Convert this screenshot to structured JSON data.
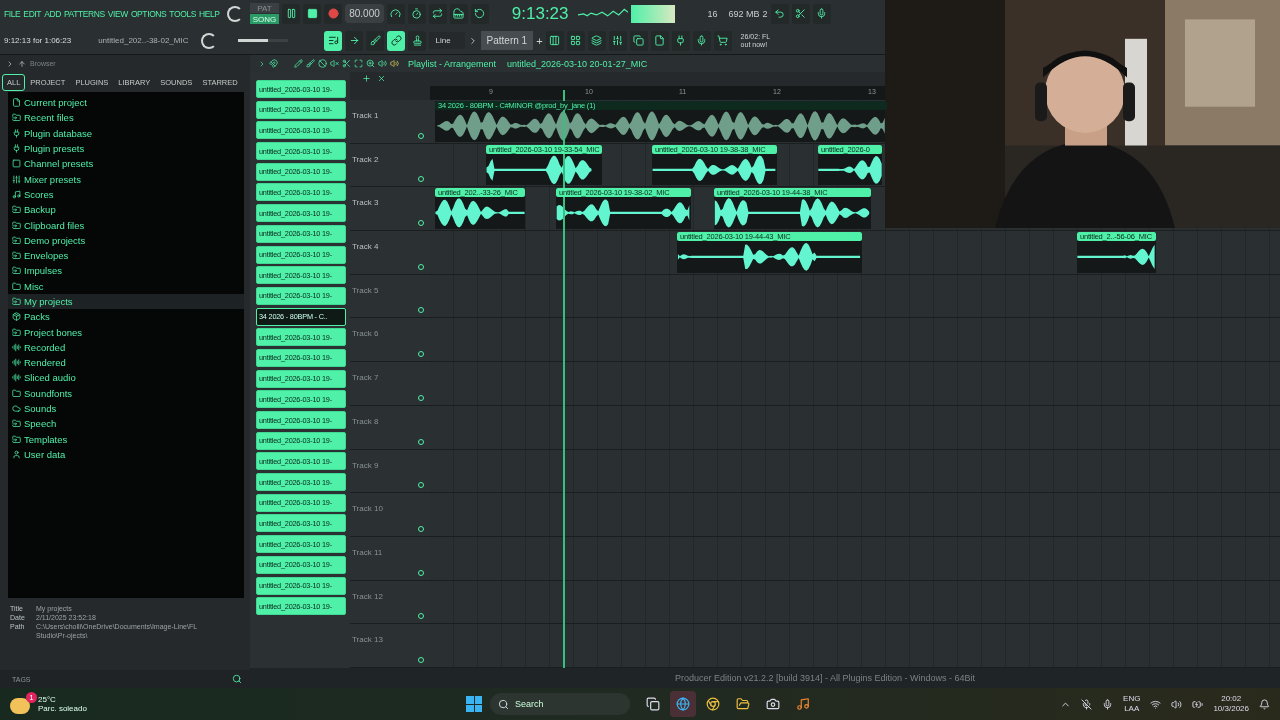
{
  "menu": [
    "FILE",
    "EDIT",
    "ADD",
    "PATTERNS",
    "VIEW",
    "OPTIONS",
    "TOOLS",
    "HELP"
  ],
  "transport": {
    "modes": [
      {
        "label": "PAT",
        "selected": false
      },
      {
        "label": "SONG",
        "selected": true
      }
    ],
    "playing": true,
    "tempo": "80.000",
    "time": "9:13:23",
    "cpu": "16",
    "memory": "692 MB",
    "polyphony": "2"
  },
  "hint": {
    "text": "9:12:13 for 1:06:23",
    "file": "untitled_202..-38-02_MIC"
  },
  "master": {
    "level": 0.6
  },
  "tools": [
    {
      "kind": "playlist",
      "on": true
    },
    {
      "kind": "arrow",
      "on": false
    },
    {
      "kind": "brush",
      "on": false
    },
    {
      "kind": "link",
      "on": true
    },
    {
      "kind": "stamp",
      "on": false
    }
  ],
  "snap": "Line",
  "pattern": "Pattern 1",
  "pattern_add": "+",
  "news": [
    "26/02: FL",
    "out now!"
  ],
  "browser": {
    "title": "Browser",
    "tabs": [
      {
        "label": "ALL",
        "selected": true
      },
      {
        "label": "PROJECT",
        "selected": false
      },
      {
        "label": "PLUGINS",
        "selected": false
      },
      {
        "label": "LIBRARY",
        "selected": false
      },
      {
        "label": "SOUNDS",
        "selected": false
      },
      {
        "label": "STARRED",
        "selected": false
      }
    ],
    "items": [
      {
        "label": "Current project",
        "kind": "file",
        "selected": false
      },
      {
        "label": "Recent files",
        "kind": "linked",
        "selected": false
      },
      {
        "label": "Plugin database",
        "kind": "plugin",
        "selected": false
      },
      {
        "label": "Plugin presets",
        "kind": "plugin",
        "selected": false
      },
      {
        "label": "Channel presets",
        "kind": "channel",
        "selected": false
      },
      {
        "label": "Mixer presets",
        "kind": "mixer",
        "selected": false
      },
      {
        "label": "Scores",
        "kind": "score",
        "selected": false
      },
      {
        "label": "Backup",
        "kind": "linked",
        "selected": false
      },
      {
        "label": "Clipboard files",
        "kind": "linked",
        "selected": false
      },
      {
        "label": "Demo projects",
        "kind": "linked",
        "selected": false
      },
      {
        "label": "Envelopes",
        "kind": "linked",
        "selected": false
      },
      {
        "label": "Impulses",
        "kind": "linked",
        "selected": false
      },
      {
        "label": "Misc",
        "kind": "folder",
        "selected": false
      },
      {
        "label": "My projects",
        "kind": "linked",
        "selected": true
      },
      {
        "label": "Packs",
        "kind": "packs",
        "selected": false
      },
      {
        "label": "Project bones",
        "kind": "linked",
        "selected": false
      },
      {
        "label": "Recorded",
        "kind": "audio",
        "selected": false
      },
      {
        "label": "Rendered",
        "kind": "audio",
        "selected": false
      },
      {
        "label": "Sliced audio",
        "kind": "audio",
        "selected": false
      },
      {
        "label": "Soundfonts",
        "kind": "folder",
        "selected": false
      },
      {
        "label": "Sounds",
        "kind": "cloud",
        "selected": false
      },
      {
        "label": "Speech",
        "kind": "linked",
        "selected": false
      },
      {
        "label": "Templates",
        "kind": "linked",
        "selected": false
      },
      {
        "label": "User data",
        "kind": "user",
        "selected": false
      }
    ],
    "info": [
      {
        "key": "Title",
        "value": "My projects"
      },
      {
        "key": "Date",
        "value": "2/11/2025 23:52:18"
      },
      {
        "key": "Path",
        "value": "C:\\Users\\cholli\\OneDrive\\Documents\\Image-Line\\FL Studio\\Pr-ojects\\"
      }
    ],
    "tags": "TAGS"
  },
  "clips_list": [
    {
      "label": "untitled_2026-03-10 19-",
      "selected": false
    },
    {
      "label": "untitled_2026-03-10 19-",
      "selected": false
    },
    {
      "label": "untitled_2026-03-10 19-",
      "selected": false
    },
    {
      "label": "untitled_2026-03-10 19-",
      "selected": false
    },
    {
      "label": "untitled_2026-03-10 19-",
      "selected": false
    },
    {
      "label": "untitled_2026-03-10 19-",
      "selected": false
    },
    {
      "label": "untitled_2026-03-10 19-",
      "selected": false
    },
    {
      "label": "untitled_2026-03-10 19-",
      "selected": false
    },
    {
      "label": "untitled_2026-03-10 19-",
      "selected": false
    },
    {
      "label": "untitled_2026-03-10 19-",
      "selected": false
    },
    {
      "label": "untitled_2026-03-10 19-",
      "selected": false
    },
    {
      "label": "34 2026 - 80BPM - C..",
      "selected": true
    },
    {
      "label": "untitled_2026-03-10 19-",
      "selected": false
    },
    {
      "label": "untitled_2026-03-10 19-",
      "selected": false
    },
    {
      "label": "untitled_2026-03-10 19-",
      "selected": false
    },
    {
      "label": "untitled_2026-03-10 19-",
      "selected": false
    },
    {
      "label": "untitled_2026-03-10 19-",
      "selected": false
    },
    {
      "label": "untitled_2026-03-10 19-",
      "selected": false
    },
    {
      "label": "untitled_2026-03-10 19-",
      "selected": false
    },
    {
      "label": "untitled_2026-03-10 19-",
      "selected": false
    },
    {
      "label": "untitled_2026-03-10 19-",
      "selected": false
    },
    {
      "label": "untitled_2026-03-10 19-",
      "selected": false
    },
    {
      "label": "untitled_2026-03-10 19-",
      "selected": false
    },
    {
      "label": "untitled_2026-03-10 19-",
      "selected": false
    },
    {
      "label": "untitled_2026-03-10 19-",
      "selected": false
    },
    {
      "label": "untitled_2026-03-10 19-",
      "selected": false
    }
  ],
  "playlist": {
    "title": "Playlist - Arrangement",
    "file": "untitled_2026-03-10 20-01-27_MIC",
    "ruler": [
      "9",
      "10",
      "11",
      "12",
      "13"
    ],
    "tracks": [
      {
        "name": "Track 1",
        "clips": [
          {
            "label": "34 2026 - 80BPM - C#MINOR @prod_by_jane (1)",
            "kind": "sample"
          }
        ]
      },
      {
        "name": "Track 2",
        "clips": [
          {
            "label": "untitled_2026-03-10 19-33-54_MIC",
            "kind": "audio"
          },
          {
            "label": "untitled_2026-03-10 19-38-38_MIC",
            "kind": "audio"
          },
          {
            "label": "untitled_2026-0",
            "kind": "audio"
          }
        ]
      },
      {
        "name": "Track 3",
        "clips": [
          {
            "label": "untitled_202..-33-26_MIC",
            "kind": "audio"
          },
          {
            "label": "untitled_2026-03-10 19-38-02_MIC",
            "kind": "audio"
          },
          {
            "label": "untitled_2026-03-10 19-44-38_MIC",
            "kind": "audio"
          }
        ]
      },
      {
        "name": "Track 4",
        "clips": [
          {
            "label": "untitled_2026-03-10 19-44-43_MIC",
            "kind": "audio"
          },
          {
            "label": "untitled_2..-56-06_MIC",
            "kind": "audio"
          }
        ]
      },
      {
        "name": "Track 5"
      },
      {
        "name": "Track 6"
      },
      {
        "name": "Track 7"
      },
      {
        "name": "Track 8"
      },
      {
        "name": "Track 9"
      },
      {
        "name": "Track 10"
      },
      {
        "name": "Track 11"
      },
      {
        "name": "Track 12"
      },
      {
        "name": "Track 13"
      }
    ]
  },
  "status": "Producer Edition v21.2.2 [build 3914] - All Plugins Edition - Windows - 64Bit",
  "taskbar": {
    "weather": {
      "temp": "25°C",
      "text": "Parc. soleado",
      "badge": "1"
    },
    "search": "Search",
    "lang": [
      "ENG",
      "LAA"
    ],
    "clock": [
      "20:02",
      "10/3/2026"
    ]
  }
}
